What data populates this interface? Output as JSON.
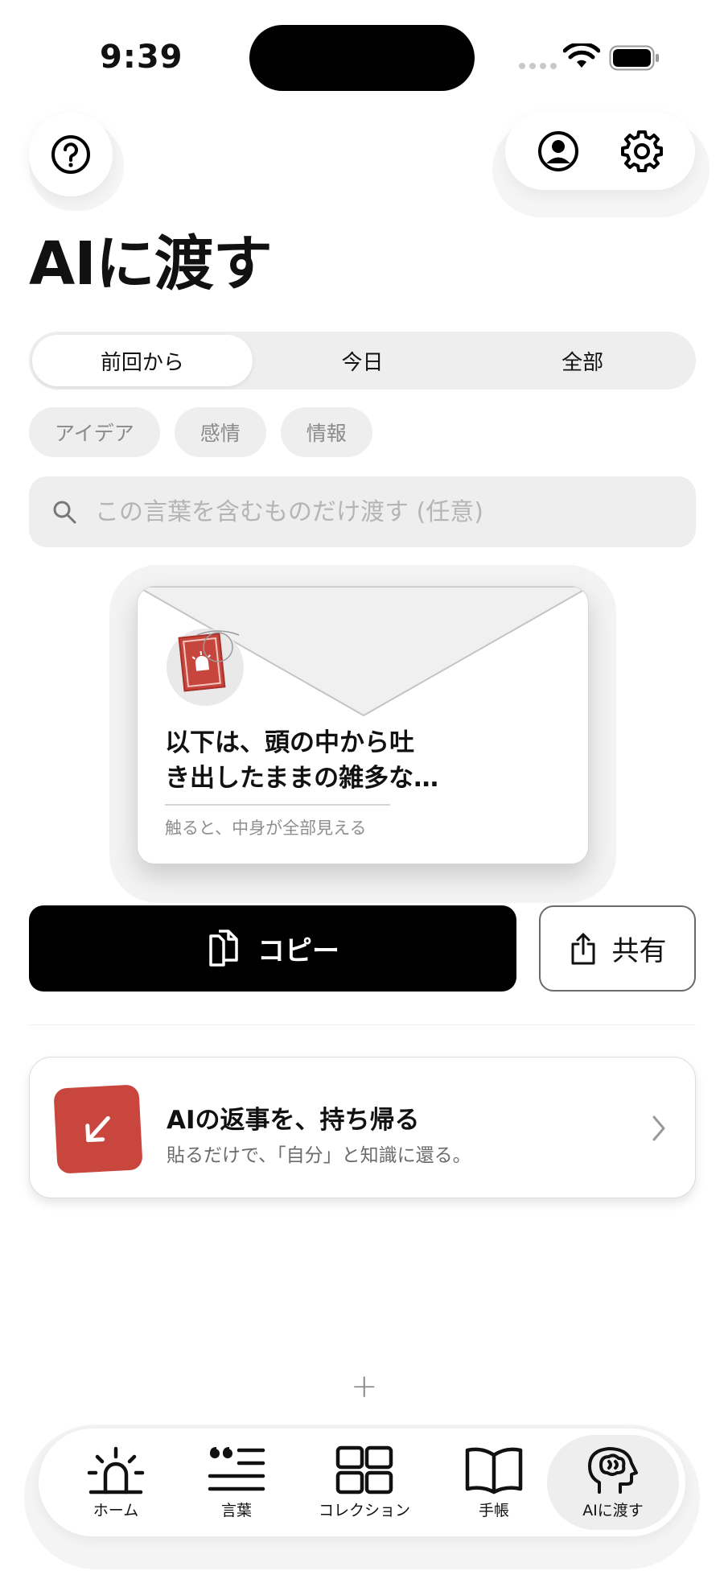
{
  "status_bar": {
    "time": "9:39"
  },
  "header": {
    "title": "AIに渡す"
  },
  "segments": [
    {
      "label": "前回から",
      "active": true
    },
    {
      "label": "今日",
      "active": false
    },
    {
      "label": "全部",
      "active": false
    }
  ],
  "chips": [
    "アイデア",
    "感情",
    "情報"
  ],
  "search": {
    "placeholder": "この言葉を含むものだけ渡す (任意)",
    "value": ""
  },
  "envelope": {
    "preview_line1": "以下は、頭の中から吐",
    "preview_line2": "き出したままの雑多な…",
    "hint": "触ると、中身が全部見える"
  },
  "actions": {
    "copy_label": "コピー",
    "share_label": "共有"
  },
  "return_card": {
    "title": "AIの返事を、持ち帰る",
    "subtitle": "貼るだけで、「自分」と知識に還る。"
  },
  "fab": {
    "plus_label": "+"
  },
  "tabs": [
    {
      "label": "ホーム",
      "icon": "lighthouse-icon"
    },
    {
      "label": "言葉",
      "icon": "quote-icon"
    },
    {
      "label": "コレクション",
      "icon": "grid-icon"
    },
    {
      "label": "手帳",
      "icon": "book-icon"
    },
    {
      "label": "AIに渡す",
      "icon": "brain-icon",
      "active": true
    }
  ],
  "colors": {
    "accent_red": "#c9463e",
    "primary_black": "#000000",
    "surface_gray": "#eeeeee"
  }
}
